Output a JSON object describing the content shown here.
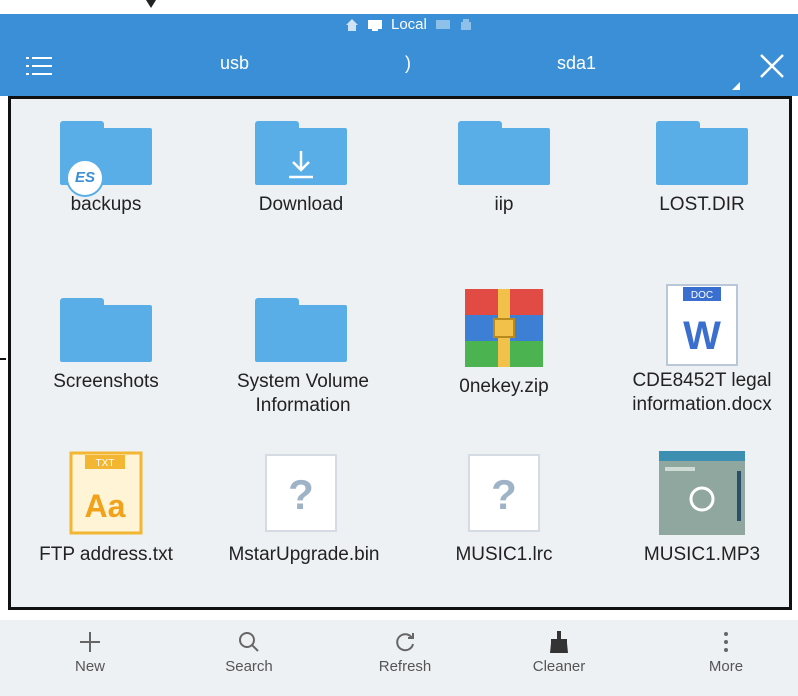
{
  "status_bar": {
    "title": "Local"
  },
  "toolbar": {
    "path": [
      "usb",
      ")",
      "sda1"
    ]
  },
  "files": [
    {
      "name": "backups",
      "icon": "folder-es-icon"
    },
    {
      "name": "Download",
      "icon": "folder-download-icon"
    },
    {
      "name": "iip",
      "icon": "folder-icon"
    },
    {
      "name": "LOST.DIR",
      "icon": "folder-icon"
    },
    {
      "name": "Screenshots",
      "icon": "folder-icon"
    },
    {
      "name": "System Volume Information",
      "icon": "folder-icon"
    },
    {
      "name": "0nekey.zip",
      "icon": "zip-archive-icon"
    },
    {
      "name": "CDE8452T legal information.docx",
      "icon": "word-doc-icon",
      "badge": "DOC",
      "letter": "W"
    },
    {
      "name": "FTP address.txt",
      "icon": "txt-file-icon",
      "badge": "TXT",
      "letter": "Aa"
    },
    {
      "name": "MstarUpgrade.bin",
      "icon": "unknown-file-icon",
      "letter": "?"
    },
    {
      "name": "MUSIC1.lrc",
      "icon": "unknown-file-icon",
      "letter": "?"
    },
    {
      "name": "MUSIC1.MP3",
      "icon": "music-thumbnail-icon"
    }
  ],
  "bottom_bar": [
    {
      "label": "New",
      "icon": "plus-icon"
    },
    {
      "label": "Search",
      "icon": "search-icon"
    },
    {
      "label": "Refresh",
      "icon": "refresh-icon"
    },
    {
      "label": "Cleaner",
      "icon": "broom-icon"
    },
    {
      "label": "More",
      "icon": "more-vertical-icon"
    }
  ],
  "colors": {
    "accent": "#3a8fd6",
    "folder": "#5aaee8",
    "background": "#eef1f4"
  }
}
